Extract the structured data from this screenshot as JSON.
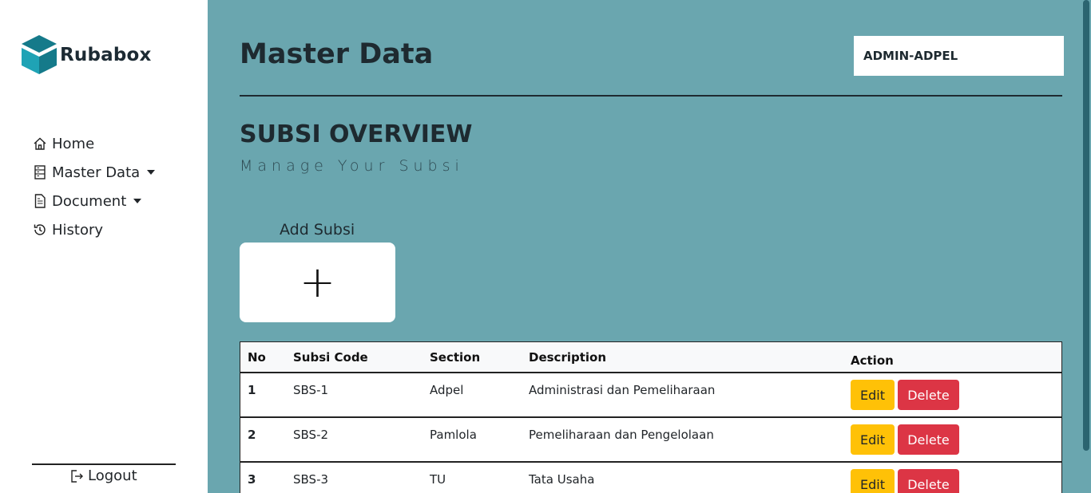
{
  "brand": {
    "name": "Rubabox",
    "colors": {
      "logo_dark": "#157a8a",
      "logo_light": "#1fa3b5"
    }
  },
  "sidebar": {
    "items": [
      {
        "label": "Home",
        "icon": "home-icon",
        "dropdown": false
      },
      {
        "label": "Master Data",
        "icon": "server-icon",
        "dropdown": true
      },
      {
        "label": "Document",
        "icon": "document-icon",
        "dropdown": true
      },
      {
        "label": "History",
        "icon": "history-icon",
        "dropdown": false
      }
    ],
    "logout_label": "Logout"
  },
  "header": {
    "title": "Master Data",
    "user": "ADMIN-ADPEL"
  },
  "overview": {
    "title": "SUBSI OVERVIEW",
    "subtitle": "Manage Your Subsi"
  },
  "add_card": {
    "label": "Add Subsi",
    "symbol": "+"
  },
  "table": {
    "columns": [
      "No",
      "Subsi Code",
      "Section",
      "Description",
      "Action"
    ],
    "rows": [
      {
        "no": "1",
        "code": "SBS-1",
        "section": "Adpel",
        "description": "Administrasi dan Pemeliharaan"
      },
      {
        "no": "2",
        "code": "SBS-2",
        "section": "Pamlola",
        "description": "Pemeliharaan dan Pengelolaan"
      },
      {
        "no": "3",
        "code": "SBS-3",
        "section": "TU",
        "description": "Tata Usaha"
      }
    ],
    "edit_label": "Edit",
    "delete_label": "Delete"
  },
  "theme": {
    "background": "#6aa6af",
    "edit": "#ffc107",
    "delete": "#dc3545"
  }
}
